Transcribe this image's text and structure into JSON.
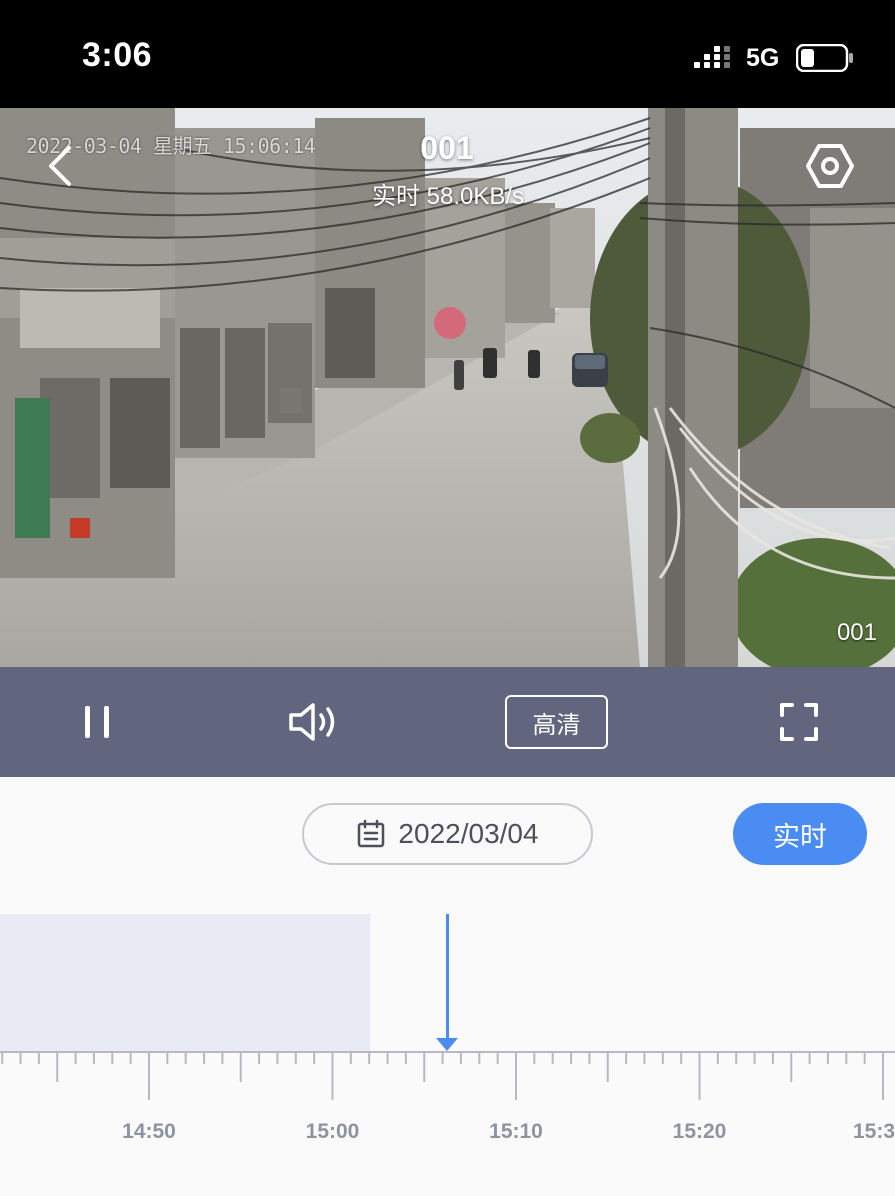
{
  "status_bar": {
    "time": "3:06",
    "network": "5G"
  },
  "video": {
    "overlay_timestamp": "2022-03-04 星期五 15:06:14",
    "title": "001",
    "rate": "实时 58.0KB/s",
    "channel_label": "001"
  },
  "controls": {
    "quality_label": "高清",
    "icons": [
      "pause-icon",
      "volume-icon",
      "fullscreen-icon"
    ]
  },
  "date_row": {
    "date": "2022/03/04",
    "live_label": "实时"
  },
  "timeline": {
    "tick_labels": [
      "14:50",
      "15:00",
      "15:10",
      "15:20",
      "15:3"
    ],
    "colors": {
      "accent": "#4b8cf2",
      "recorded": "#e8ebf4",
      "control_bar": "#61657e"
    }
  }
}
